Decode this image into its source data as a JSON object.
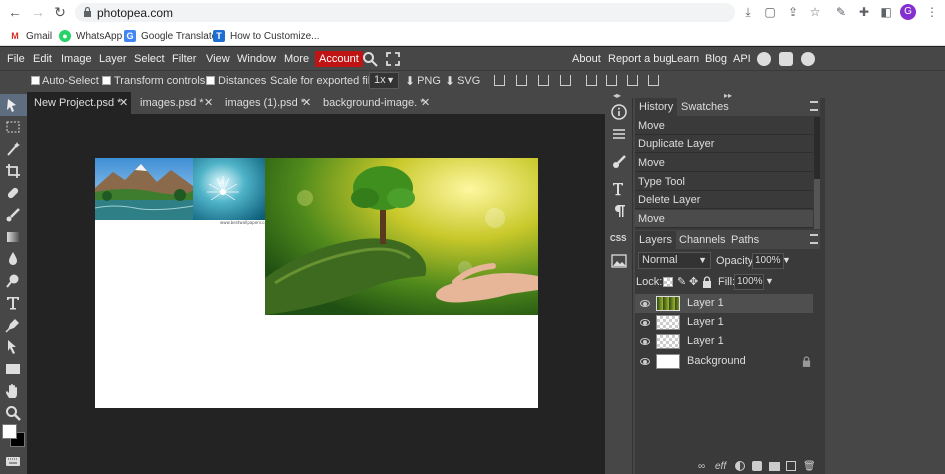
{
  "browser": {
    "url": "photopea.com",
    "avatar_letter": "G",
    "bookmarks": [
      {
        "label": "Gmail",
        "icon": "gmail-icon",
        "color": "#d93025"
      },
      {
        "label": "WhatsApp",
        "icon": "whatsapp-icon",
        "color": "#25d366"
      },
      {
        "label": "Google Translate",
        "icon": "translate-icon",
        "color": "#4285f4"
      },
      {
        "label": "How to Customize...",
        "icon": "tg-icon",
        "color": "#1c6fd1"
      }
    ]
  },
  "menu": {
    "items": [
      "File",
      "Edit",
      "Image",
      "Layer",
      "Select",
      "Filter",
      "View",
      "Window",
      "More"
    ],
    "account": "Account",
    "right_links": [
      "About",
      "Report a bug",
      "Learn",
      "Blog",
      "API"
    ]
  },
  "options": {
    "auto_select": "Auto-Select",
    "transform_controls": "Transform controls",
    "distances": "Distances",
    "scale_label": "Scale for exported files:",
    "scale_value": "1x",
    "png": "PNG",
    "svg": "SVG"
  },
  "tabs": [
    {
      "label": "New Project.psd *",
      "active": true
    },
    {
      "label": "images.psd *",
      "active": false
    },
    {
      "label": "images (1).psd *",
      "active": false
    },
    {
      "label": "background-image. *",
      "active": false
    }
  ],
  "history": {
    "tabs": [
      "History",
      "Swatches"
    ],
    "items": [
      "Move",
      "Duplicate Layer",
      "Move",
      "Type Tool",
      "Delete Layer",
      "Move"
    ]
  },
  "layers": {
    "tabs": [
      "Layers",
      "Channels",
      "Paths"
    ],
    "blend_mode": "Normal",
    "opacity_label": "Opacity:",
    "opacity_value": "100%",
    "lock_label": "Lock:",
    "fill_label": "Fill:",
    "fill_value": "100%",
    "items": [
      {
        "name": "Layer 1",
        "selected": true
      },
      {
        "name": "Layer 1",
        "selected": false
      },
      {
        "name": "Layer 1",
        "selected": false
      },
      {
        "name": "Background",
        "selected": false
      }
    ],
    "footer_fx": "eff"
  },
  "colors": {
    "account": "#c01414",
    "tool_selected": "#5e6d80",
    "panel_bg": "#3a3a3a",
    "workspace": "#232323"
  },
  "canvas_image_caption": "www.bestwallpapers.com"
}
